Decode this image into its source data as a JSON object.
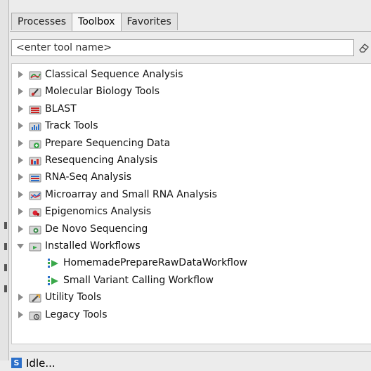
{
  "tabs": [
    {
      "label": "Processes",
      "active": false
    },
    {
      "label": "Toolbox",
      "active": true
    },
    {
      "label": "Favorites",
      "active": false
    }
  ],
  "search": {
    "placeholder": "<enter tool name>",
    "value": ""
  },
  "tree": [
    {
      "label": "Classical Sequence Analysis",
      "icon": "classical-sequence-analysis-icon",
      "expanded": false
    },
    {
      "label": "Molecular Biology Tools",
      "icon": "molecular-biology-tools-icon",
      "expanded": false
    },
    {
      "label": "BLAST",
      "icon": "blast-icon",
      "expanded": false
    },
    {
      "label": "Track Tools",
      "icon": "track-tools-icon",
      "expanded": false
    },
    {
      "label": "Prepare Sequencing Data",
      "icon": "prepare-sequencing-data-icon",
      "expanded": false
    },
    {
      "label": "Resequencing Analysis",
      "icon": "resequencing-analysis-icon",
      "expanded": false
    },
    {
      "label": "RNA-Seq Analysis",
      "icon": "rna-seq-analysis-icon",
      "expanded": false
    },
    {
      "label": "Microarray and Small RNA Analysis",
      "icon": "microarray-icon",
      "expanded": false
    },
    {
      "label": "Epigenomics Analysis",
      "icon": "epigenomics-analysis-icon",
      "expanded": false
    },
    {
      "label": "De Novo Sequencing",
      "icon": "de-novo-sequencing-icon",
      "expanded": false
    },
    {
      "label": "Installed Workflows",
      "icon": "installed-workflows-icon",
      "expanded": true,
      "children": [
        {
          "label": "HomemadePrepareRawDataWorkflow",
          "icon": "workflow-icon"
        },
        {
          "label": "Small Variant Calling Workflow",
          "icon": "workflow-icon"
        }
      ]
    },
    {
      "label": "Utility Tools",
      "icon": "utility-tools-icon",
      "expanded": false
    },
    {
      "label": "Legacy Tools",
      "icon": "legacy-tools-icon",
      "expanded": false
    }
  ],
  "status": {
    "icon_letter": "S",
    "text": "Idle..."
  },
  "colors": {
    "arrow": "#8a8a8a",
    "folder_body": "#dcdcdc",
    "status_icon": "#2b6fc9"
  }
}
